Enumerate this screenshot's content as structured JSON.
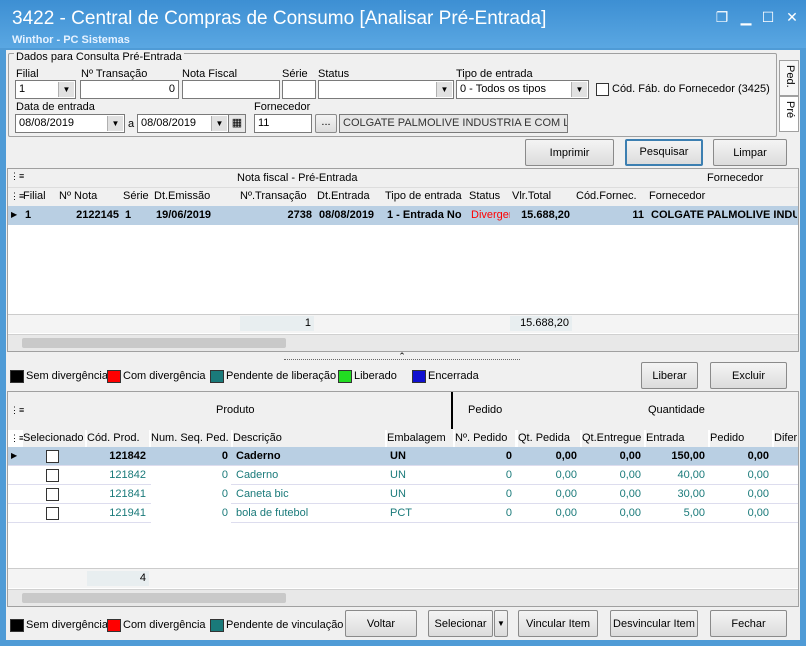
{
  "window": {
    "title": "3422 - Central de Compras de Consumo [Analisar Pré-Entrada]",
    "subtitle": "Winthor - PC Sistemas"
  },
  "filter": {
    "group_label": "Dados para Consulta Pré-Entrada",
    "filial_label": "Filial",
    "filial_value": "1",
    "transacao_label": "Nº Transação",
    "transacao_value": "0",
    "nota_label": "Nota Fiscal",
    "nota_value": "",
    "serie_label": "Série",
    "serie_value": "",
    "status_label": "Status",
    "status_value": "",
    "tipo_label": "Tipo de entrada",
    "tipo_value": "0 - Todos os tipos",
    "cod_fab_label": "Cód. Fáb. do Fornecedor (3425)",
    "data_label": "Data de entrada",
    "data_from": "08/08/2019",
    "data_sep": "a",
    "data_to": "08/08/2019",
    "fornecedor_label": "Fornecedor",
    "fornecedor_code": "11",
    "fornecedor_btn": "...",
    "fornecedor_name": "COLGATE PALMOLIVE INDUSTRIA  E COM LTDA"
  },
  "side_tabs": [
    "Ped.",
    "Pré"
  ],
  "actions": {
    "imprimir": "Imprimir",
    "pesquisar": "Pesquisar",
    "limpar": "Limpar"
  },
  "top_grid": {
    "band_nota": "Nota fiscal - Pré-Entrada",
    "band_forn": "Fornecedor",
    "columns": [
      "Filial",
      "Nº Nota",
      "Série",
      "Dt.Emissão",
      "Nº.Transação",
      "Dt.Entrada",
      "Tipo de entrada",
      "Status",
      "Vlr.Total",
      "Cód.Fornec.",
      "Fornecedor"
    ],
    "rows": [
      [
        "1",
        "2122145",
        "1",
        "19/06/2019",
        "2738",
        "08/08/2019",
        "1 - Entrada No",
        "Divergen",
        "15.688,20",
        "11",
        "COLGATE PALMOLIVE INDUS"
      ]
    ],
    "footer_count": "1",
    "footer_total": "15.688,20"
  },
  "legend1": [
    "Sem divergência",
    "Com divergência",
    "Pendente de liberação",
    "Liberado",
    "Encerrada"
  ],
  "legend_colors": {
    "sem": "#000000",
    "com": "#ff0000",
    "pendente": "#1a7a7a",
    "liberado": "#22dd22",
    "encerrada": "#1010d0"
  },
  "mid_actions": {
    "liberar": "Liberar",
    "excluir": "Excluir"
  },
  "bottom_grid": {
    "band_produto": "Produto",
    "band_pedido": "Pedido",
    "band_quantidade": "Quantidade",
    "columns": [
      "Selecionado",
      "Cód. Prod.",
      "Num. Seq. Ped.",
      "Descrição",
      "Embalagem",
      "Nº. Pedido",
      "Qt. Pedida",
      "Qt.Entregue",
      "Entrada",
      "Pedido",
      "Difer"
    ],
    "rows": [
      [
        "121842",
        "0",
        "Caderno",
        "UN",
        "0",
        "0,00",
        "0,00",
        "150,00",
        "0,00"
      ],
      [
        "121842",
        "0",
        "Caderno",
        "UN",
        "0",
        "0,00",
        "0,00",
        "40,00",
        "0,00"
      ],
      [
        "121841",
        "0",
        "Caneta bic",
        "UN",
        "0",
        "0,00",
        "0,00",
        "30,00",
        "0,00"
      ],
      [
        "121941",
        "0",
        "bola de futebol",
        "PCT",
        "0",
        "0,00",
        "0,00",
        "5,00",
        "0,00"
      ]
    ],
    "footer_count": "4"
  },
  "legend2": [
    "Sem divergência",
    "Com divergência",
    "Pendente de vinculação"
  ],
  "bottom_actions": {
    "voltar": "Voltar",
    "selecionar": "Selecionar",
    "vincular": "Vincular Item",
    "desvincular": "Desvincular Item",
    "fechar": "Fechar"
  }
}
